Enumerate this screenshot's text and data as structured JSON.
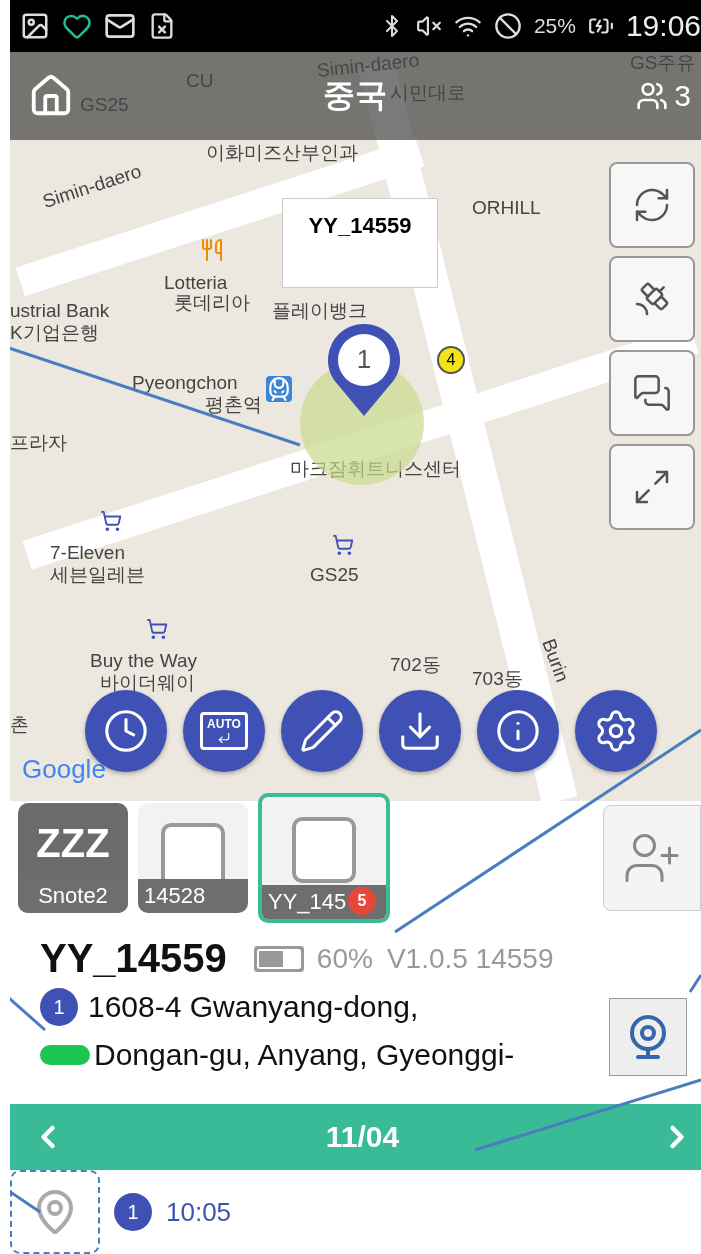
{
  "status_bar": {
    "battery": "25%",
    "time": "19:06"
  },
  "header": {
    "title": "중국",
    "member_count": "3"
  },
  "map": {
    "labels": [
      "CU",
      "GS25",
      "Simin-daero",
      "시민대로",
      "이화미즈산부인과",
      "Simin-daero",
      "ORHILL",
      "ustrial Bank",
      "K기업은행",
      "Lotteria",
      "롯데리아",
      "플레이뱅크",
      "Pyeongchon",
      "평촌역",
      "프라자",
      "마크잠휘트니스센터",
      "7-Eleven",
      "세븐일레븐",
      "GS25",
      "Buy the Way",
      "바이더웨이",
      "702동",
      "703동",
      "Burin",
      "촌",
      "GS주유",
      "Google"
    ],
    "popup": "YY_14559",
    "marker": "1",
    "poi_badge": "4"
  },
  "map_buttons": [
    {
      "kind": "refresh"
    },
    {
      "kind": "satellite"
    },
    {
      "kind": "chat"
    },
    {
      "kind": "fullscreen"
    }
  ],
  "actions": [
    {
      "kind": "history"
    },
    {
      "kind": "auto",
      "label": "AUTO"
    },
    {
      "kind": "edit"
    },
    {
      "kind": "download"
    },
    {
      "kind": "info"
    },
    {
      "kind": "settings"
    }
  ],
  "devices": [
    {
      "label": "Snote2",
      "kind": "sleeping",
      "sleep_text": "ZZZ",
      "selected": false
    },
    {
      "label": "14528",
      "kind": "tracker",
      "selected": false
    },
    {
      "label": "YY_145",
      "kind": "tracker",
      "selected": true,
      "badge": "5"
    }
  ],
  "device_info": {
    "name": "YY_14559",
    "battery_icon": {
      "level": 0.6
    },
    "battery": "60%",
    "version": "V1.0.5 14559",
    "point": "1",
    "address_lines": [
      "1608-4 Gwanyang-dong,",
      "Dongan-gu, Anyang, Gyeonggi-"
    ]
  },
  "date_bar": {
    "date": "11/04"
  },
  "timeline": [
    {
      "number": "1",
      "time": "10:05"
    }
  ]
}
